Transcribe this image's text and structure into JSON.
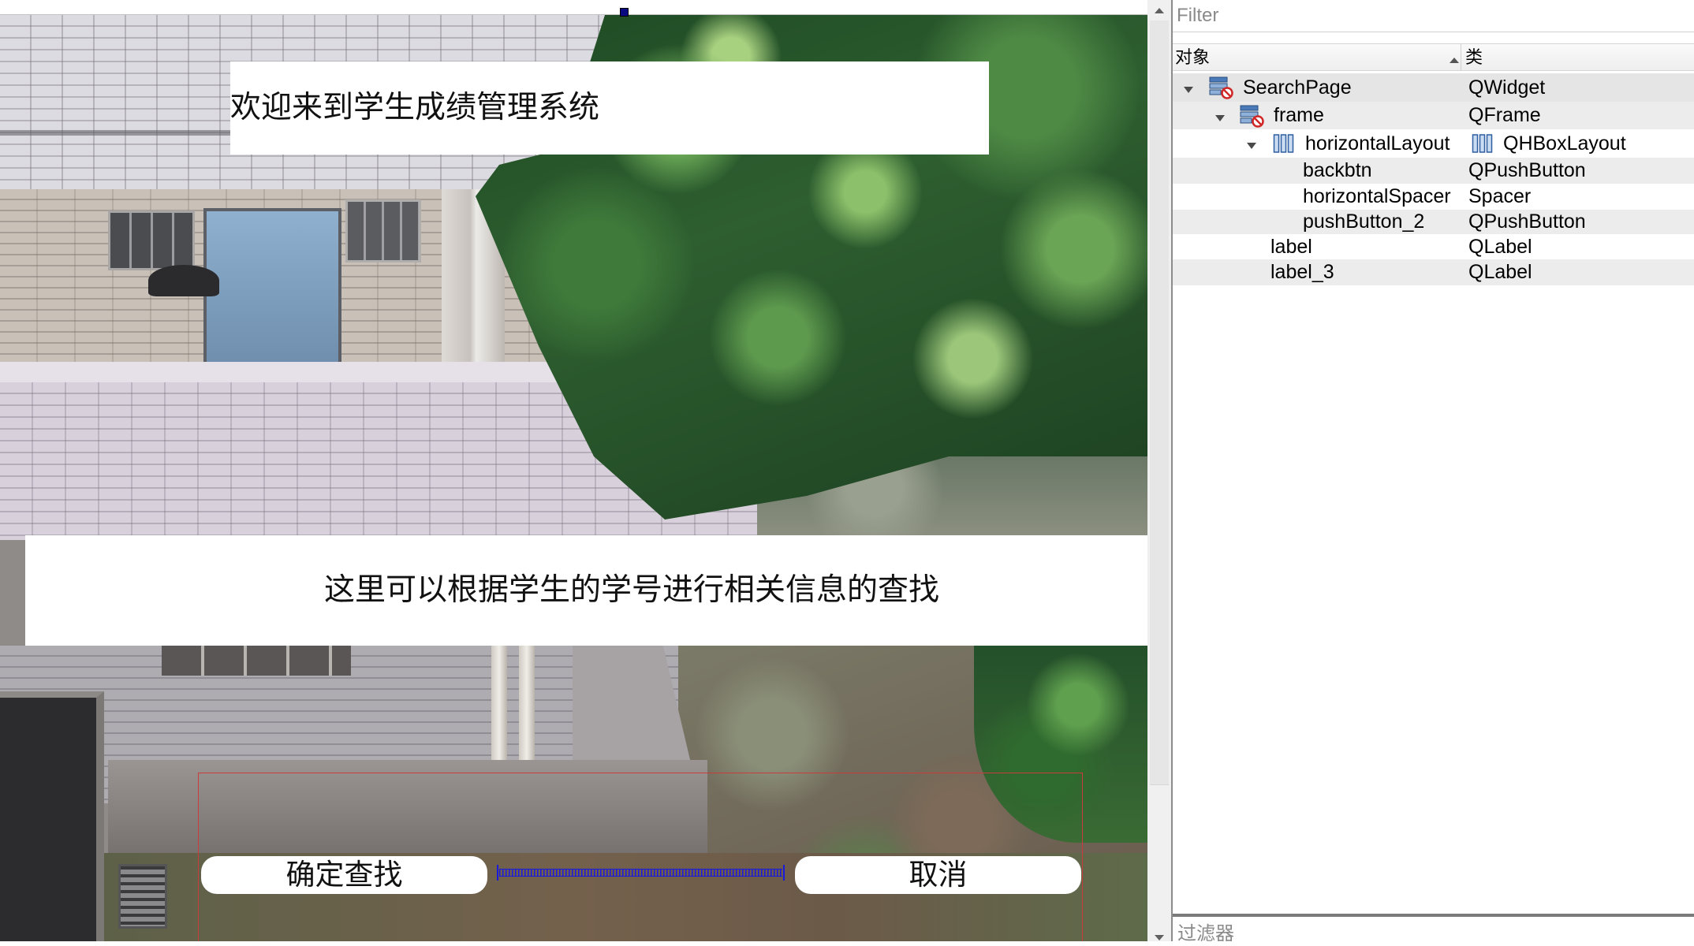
{
  "designer_form": {
    "title_label": "欢迎来到学生成绩管理系统",
    "description_label": "这里可以根据学生的学号进行相关信息的查找",
    "confirm_button": "确定查找",
    "cancel_button": "取消"
  },
  "object_inspector": {
    "filter_placeholder": "Filter",
    "column_object": "对象",
    "column_class": "类",
    "sort_icon": "sort-ascending-icon",
    "rows": [
      {
        "object": "SearchPage",
        "class": "QWidget",
        "level": 0,
        "expanded": true,
        "icon": "form-broken-layout-icon"
      },
      {
        "object": "frame",
        "class": "QFrame",
        "level": 1,
        "expanded": true,
        "icon": "form-broken-layout-icon"
      },
      {
        "object": "horizontalLayout",
        "class": "QHBoxLayout",
        "level": 2,
        "expanded": true,
        "icon": "hbox-layout-icon",
        "class_icon": "hbox-layout-icon"
      },
      {
        "object": "backbtn",
        "class": "QPushButton",
        "level": 3
      },
      {
        "object": "horizontalSpacer",
        "class": "Spacer",
        "level": 3
      },
      {
        "object": "pushButton_2",
        "class": "QPushButton",
        "level": 3
      },
      {
        "object": "label",
        "class": "QLabel",
        "level": 1
      },
      {
        "object": "label_3",
        "class": "QLabel",
        "level": 1
      }
    ]
  },
  "property_editor": {
    "filter_placeholder": "过滤器"
  },
  "colors": {
    "selection_handle": "#0a0a80",
    "frame_outline": "#c83c3c",
    "spacer": "#1a1adb",
    "row_alternate": "#ececec",
    "layout_icon": "#2f5fa0",
    "broken_layout_mark": "#d02828"
  }
}
